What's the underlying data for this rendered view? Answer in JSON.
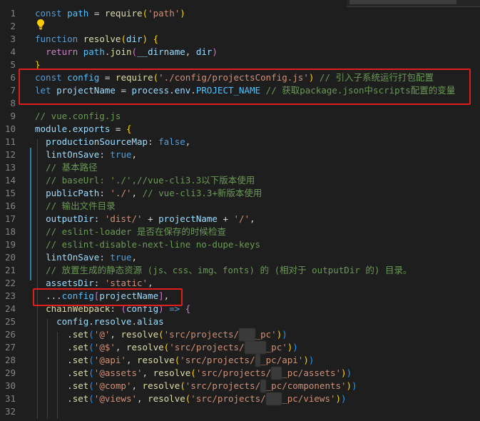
{
  "editor": {
    "lines": [
      {
        "n": "1",
        "html": "<span class='kw'>const</span> <span class='cst'>path</span> <span class='pun'>=</span> <span class='fn'>require</span><span class='brk'>(</span><span class='str'>'path'</span><span class='brk'>)</span>"
      },
      {
        "n": "2",
        "html": ""
      },
      {
        "n": "3",
        "html": "<span class='kw'>function</span> <span class='fn'>resolve</span><span class='brk'>(</span><span class='var'>dir</span><span class='brk'>)</span> <span class='brk'>{</span>"
      },
      {
        "n": "4",
        "html": "  <span class='ctl'>return</span> <span class='cst'>path</span>.<span class='fn'>join</span><span class='brk2'>(</span><span class='var'>__dirname</span>, <span class='var'>dir</span><span class='brk2'>)</span>"
      },
      {
        "n": "5",
        "html": "<span class='brk'>}</span>"
      },
      {
        "n": "6",
        "html": "<span class='kw'>const</span> <span class='cst'>config</span> <span class='pun'>=</span> <span class='fn'>require</span><span class='brk'>(</span><span class='str'>'./config/projectsConfig.js'</span><span class='brk'>)</span> <span class='cmt'>// 引入子系统运行打包配置</span>"
      },
      {
        "n": "7",
        "html": "<span class='kw'>let</span> <span class='var'>projectName</span> <span class='pun'>=</span> <span class='var'>process</span>.<span class='var'>env</span>.<span class='cst'>PROJECT_NAME</span> <span class='cmt'>// 获取package.json中scripts配置的变量</span>"
      },
      {
        "n": "8",
        "html": ""
      },
      {
        "n": "9",
        "html": "<span class='cmt'>// vue.config.js</span>"
      },
      {
        "n": "10",
        "html": "<span class='var'>module</span>.<span class='var'>exports</span> <span class='pun'>=</span> <span class='brk'>{</span>"
      },
      {
        "n": "11",
        "html": "  <span class='var'>productionSourceMap</span>: <span class='kw'>false</span>,"
      },
      {
        "n": "12",
        "html": "  <span class='var'>lintOnSave</span>: <span class='kw'>true</span>,"
      },
      {
        "n": "13",
        "html": "  <span class='cmt'>// 基本路径</span>"
      },
      {
        "n": "14",
        "html": "  <span class='cmt'>// baseUrl: './',//vue-cli3.3以下版本使用</span>"
      },
      {
        "n": "15",
        "html": "  <span class='var'>publicPath</span>: <span class='str'>'./'</span>, <span class='cmt'>// vue-cli3.3+新版本使用</span>"
      },
      {
        "n": "16",
        "html": "  <span class='cmt'>// 输出文件目录</span>"
      },
      {
        "n": "17",
        "html": "  <span class='var'>outputDir</span>: <span class='str'>'dist/'</span> <span class='pun'>+</span> <span class='var'>projectName</span> <span class='pun'>+</span> <span class='str'>'/'</span>,"
      },
      {
        "n": "18",
        "html": "  <span class='cmt'>// eslint-loader 是否在保存的时候检查</span>"
      },
      {
        "n": "19",
        "html": "  <span class='cmt'>// eslint-disable-next-line no-dupe-keys</span>"
      },
      {
        "n": "20",
        "html": "  <span class='var'>lintOnSave</span>: <span class='kw'>true</span>,"
      },
      {
        "n": "21",
        "html": "  <span class='cmt'>// 放置生成的静态资源 (js、css、img、fonts) 的 (相对于 outputDir 的) 目录。</span>"
      },
      {
        "n": "22",
        "html": "  <span class='var'>assetsDir</span>: <span class='str'>'static'</span>,"
      },
      {
        "n": "23",
        "html": "  ...<span class='cst'>config</span><span class='brk2'>[</span><span class='var'>projectName</span><span class='brk2'>]</span>,"
      },
      {
        "n": "24",
        "html": "  <span class='fn'>chainWebpack</span>: <span class='brk2'>(</span><span class='var'>config</span><span class='brk2'>)</span> <span class='kw'>=&gt;</span> <span class='brk2'>{</span>"
      },
      {
        "n": "25",
        "html": "    <span class='var'>config</span>.<span class='var'>resolve</span>.<span class='var'>alias</span>"
      },
      {
        "n": "26",
        "html": "      .<span class='fn'>set</span><span class='brk3'>(</span><span class='str'>'@'</span>, <span class='fn'>resolve</span><span class='brk'>(</span><span class='str'>'src/projects/<span class=\"blur\">xxx</span>_pc'</span><span class='brk'>)</span><span class='brk3'>)</span>"
      },
      {
        "n": "27",
        "html": "      .<span class='fn'>set</span><span class='brk3'>(</span><span class='str'>'@$'</span>, <span class='fn'>resolve</span><span class='brk'>(</span><span class='str'>'src/projects/<span class=\"blur\">xxxx</span>_pc'</span><span class='brk'>)</span><span class='brk3'>)</span>"
      },
      {
        "n": "28",
        "html": "      .<span class='fn'>set</span><span class='brk3'>(</span><span class='str'>'@api'</span>, <span class='fn'>resolve</span><span class='brk'>(</span><span class='str'>'src/projects/<span class=\"blur\">x</span>_pc/api'</span><span class='brk'>)</span><span class='brk3'>)</span>"
      },
      {
        "n": "29",
        "html": "      .<span class='fn'>set</span><span class='brk3'>(</span><span class='str'>'@assets'</span>, <span class='fn'>resolve</span><span class='brk'>(</span><span class='str'>'src/projects/<span class=\"blur\">xx</span>_pc/assets'</span><span class='brk'>)</span><span class='brk3'>)</span>"
      },
      {
        "n": "30",
        "html": "      .<span class='fn'>set</span><span class='brk3'>(</span><span class='str'>'@comp'</span>, <span class='fn'>resolve</span><span class='brk'>(</span><span class='str'>'src/projects/<span class=\"blur\">x</span>_pc/components'</span><span class='brk'>)</span><span class='brk3'>)</span>"
      },
      {
        "n": "31",
        "html": "      .<span class='fn'>set</span><span class='brk3'>(</span><span class='str'>'@views'</span>, <span class='fn'>resolve</span><span class='brk'>(</span><span class='str'>'src/projects/<span class=\"blur\">xxx</span>_pc/views'</span><span class='brk'>)</span><span class='brk3'>)</span>"
      },
      {
        "n": "32",
        "html": ""
      }
    ]
  },
  "icons": {
    "lightbulb": "lightbulb-icon"
  },
  "colors": {
    "background": "#1e1e1e",
    "highlight_box": "#e01e1e"
  }
}
